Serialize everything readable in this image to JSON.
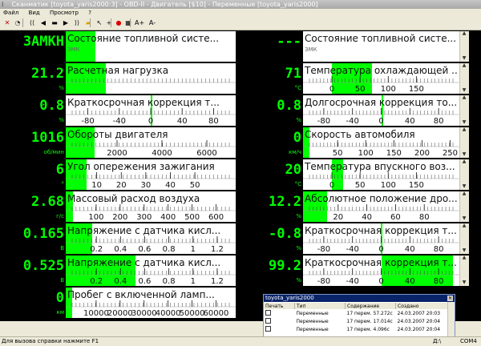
{
  "window": {
    "title": "Сканматик [toyota_yaris2000:3] - OBD-II - Двигатель [$10] - Переменные [toyota_yaris2000]",
    "icon": "I"
  },
  "menu": [
    "Файл",
    "Вид",
    "Просмотр",
    "?"
  ],
  "toolbar": {
    "items": [
      {
        "name": "close-icon",
        "glyph": "✕",
        "color": "#c00000"
      },
      {
        "name": "instrument-icon",
        "glyph": "◔",
        "color": "#333333"
      },
      {
        "name": "back-icon",
        "glyph": "⟨⟨",
        "color": "#000000"
      },
      {
        "name": "prev-icon",
        "glyph": "◀",
        "color": "#000000"
      },
      {
        "name": "display-icon",
        "glyph": "▬",
        "color": "#000000"
      },
      {
        "name": "next-icon",
        "glyph": "▶",
        "color": "#000000"
      },
      {
        "name": "forward-icon",
        "glyph": "⟩⟩",
        "color": "#000000"
      },
      {
        "name": "folder-icon",
        "glyph": "▰",
        "color": "#d8a000"
      },
      {
        "name": "pointer-icon",
        "glyph": "↖",
        "color": "#000000"
      },
      {
        "name": "add-icon",
        "glyph": "+",
        "color": "#000000"
      },
      {
        "name": "record-icon",
        "glyph": "●",
        "color": "#e00000"
      },
      {
        "name": "grid-icon",
        "glyph": "▦",
        "color": "#000000"
      },
      {
        "name": "font-increase-icon",
        "glyph": "A+",
        "color": "#000000"
      },
      {
        "name": "font-decrease-icon",
        "glyph": "A-",
        "color": "#000000"
      }
    ]
  },
  "gauges_left": [
    {
      "value": "ЗАМКН",
      "unit": "",
      "label": "Состояние топливной систе...",
      "sub": "ЗМК",
      "kind": "status",
      "level": 0.35
    },
    {
      "value": "21.2",
      "unit": "%",
      "label": "Расчетная нагрузка",
      "kind": "bar",
      "min": 0,
      "max": 100,
      "v": 21.2,
      "ticks": [],
      "scale": "none"
    },
    {
      "value": "0.8",
      "unit": "%",
      "label": "Краткосрочная коррекция т...",
      "kind": "bar",
      "min": -100,
      "max": 100,
      "v": 0.8,
      "ticks": [
        "-80",
        "-40",
        "0",
        "40",
        "80"
      ],
      "tickvals": [
        -80,
        -40,
        0,
        40,
        80
      ]
    },
    {
      "value": "1016",
      "unit": "об/мин",
      "label": "Обороты двигателя",
      "kind": "bar",
      "min": 0,
      "max": 7000,
      "v": 1016,
      "ticks": [
        "2000",
        "4000",
        "6000"
      ],
      "tickvals": [
        2000,
        4000,
        6000
      ]
    },
    {
      "value": "6",
      "unit": "°",
      "label": "Угол опережения зажигания",
      "kind": "bar",
      "min": 0,
      "max": 64,
      "v": 6,
      "ticks": [
        "10",
        "20",
        "30",
        "40",
        "50"
      ],
      "tickvals": [
        10,
        20,
        30,
        40,
        50
      ]
    },
    {
      "value": "2.68",
      "unit": "г/с",
      "label": "Массовый расход воздуха",
      "kind": "bar",
      "min": 0,
      "max": 655,
      "v": 2.68,
      "ticks": [
        "100",
        "200",
        "300",
        "400",
        "500",
        "600"
      ],
      "tickvals": [
        100,
        200,
        300,
        400,
        500,
        600
      ]
    },
    {
      "value": "0.165",
      "unit": "В",
      "label": "Напряжение с датчика кисл...",
      "kind": "bar",
      "min": 0,
      "max": 1.3,
      "v": 0.165,
      "ticks": [
        "0.2",
        "0.4",
        "0.6",
        "0.8",
        "1",
        "1.2"
      ],
      "tickvals": [
        0.2,
        0.4,
        0.6,
        0.8,
        1.0,
        1.2
      ]
    },
    {
      "value": "0.525",
      "unit": "В",
      "label": "Напряжение с датчика кисл...",
      "kind": "bar",
      "min": 0,
      "max": 1.3,
      "v": 0.525,
      "ticks": [
        "0.2",
        "0.4",
        "0.6",
        "0.8",
        "1",
        "1.2"
      ],
      "tickvals": [
        0.2,
        0.4,
        0.6,
        0.8,
        1.0,
        1.2
      ]
    },
    {
      "value": "0",
      "unit": "км",
      "label": "Пробег с включенной ламп...",
      "kind": "bar",
      "min": 0,
      "max": 65535,
      "v": 0,
      "ticks": [
        "10000",
        "20000",
        "30000",
        "40000",
        "50000",
        "60000"
      ],
      "tickvals": [
        10000,
        20000,
        30000,
        40000,
        50000,
        60000
      ]
    }
  ],
  "gauges_right": [
    {
      "value": "---",
      "unit": "",
      "label": "Состояние топливной систе...",
      "sub": "ЗМК",
      "kind": "status",
      "level": 0
    },
    {
      "value": "71",
      "unit": "°C",
      "label": "Температура охлаждающей ...",
      "kind": "bar",
      "min": -40,
      "max": 215,
      "v": 71,
      "ticks": [
        "0",
        "50",
        "100",
        "150"
      ],
      "tickvals": [
        0,
        50,
        100,
        150
      ]
    },
    {
      "value": "0.8",
      "unit": "%",
      "label": "Долгосрочная коррекция то...",
      "kind": "bar",
      "min": -100,
      "max": 100,
      "v": 0.8,
      "ticks": [
        "-80",
        "-40",
        "0",
        "40",
        "80"
      ],
      "tickvals": [
        -80,
        -40,
        0,
        40,
        80
      ]
    },
    {
      "value": "0",
      "unit": "км/ч",
      "label": "Скорость автомобиля",
      "kind": "bar",
      "min": 0,
      "max": 255,
      "v": 0,
      "ticks": [
        "50",
        "100",
        "150",
        "200",
        "250"
      ],
      "tickvals": [
        50,
        100,
        150,
        200,
        250
      ]
    },
    {
      "value": "20",
      "unit": "°C",
      "label": "Температура впускного воз...",
      "kind": "bar",
      "min": -40,
      "max": 215,
      "v": 20,
      "ticks": [
        "0",
        "50",
        "100",
        "150"
      ],
      "tickvals": [
        0,
        50,
        100,
        150
      ]
    },
    {
      "value": "12.2",
      "unit": "%",
      "label": "Абсолютное положение дро...",
      "kind": "bar",
      "min": 0,
      "max": 100,
      "v": 12.2,
      "ticks": [
        "20",
        "40",
        "60",
        "80"
      ],
      "tickvals": [
        20,
        40,
        60,
        80
      ]
    },
    {
      "value": "-0.8",
      "unit": "%",
      "label": "Краткосрочная коррекция т...",
      "kind": "bar",
      "min": -100,
      "max": 100,
      "v": -0.8,
      "ticks": [
        "-80",
        "-40",
        "0",
        "40",
        "80"
      ],
      "tickvals": [
        -80,
        -40,
        0,
        40,
        80
      ]
    },
    {
      "value": "99.2",
      "unit": "%",
      "label": "Краткосрочная коррекция т...",
      "kind": "bar",
      "min": -100,
      "max": 100,
      "v": 99.2,
      "ticks": [
        "-80",
        "-40",
        "0",
        "40",
        "80"
      ],
      "tickvals": [
        -80,
        -40,
        0,
        40,
        80
      ]
    }
  ],
  "popup": {
    "title": "toyota_yaris2000",
    "columns": [
      "Печать",
      "Тип",
      "Содержание",
      "Создано"
    ],
    "rows": [
      {
        "type": "Переменные",
        "content": "17 перем. 57.272с",
        "created": "24.03.2007 20:03"
      },
      {
        "type": "Переменные",
        "content": "17 перем. 17.014с",
        "created": "24.03.2007 20:04"
      },
      {
        "type": "Переменные",
        "content": "17 перем. 4.096с",
        "created": "24.03.2007 20:04"
      }
    ]
  },
  "status": {
    "hint": "Для вызова справки нажмите F1",
    "b1": "Д:\\",
    "b2": "СОМ4"
  },
  "colors": {
    "accent": "#00ff00",
    "background": "#000000"
  }
}
